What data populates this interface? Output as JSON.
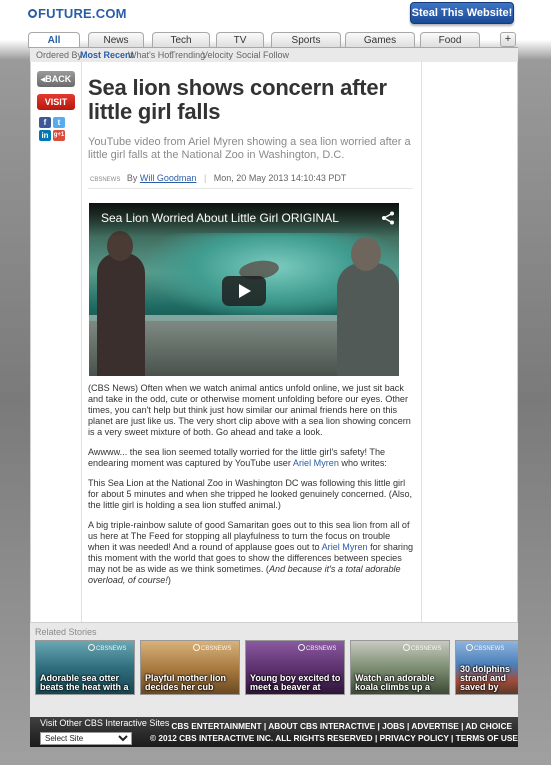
{
  "header": {
    "logo": "FUTURE.COM",
    "steal_button": "Steal This Website!"
  },
  "tabs": [
    {
      "label": "All",
      "active": true
    },
    {
      "label": "News"
    },
    {
      "label": "Tech"
    },
    {
      "label": "TV"
    },
    {
      "label": "Sports"
    },
    {
      "label": "Games"
    },
    {
      "label": "Food"
    }
  ],
  "tab_add_label": "+",
  "order_bar": {
    "label": "Ordered By",
    "options": [
      "Most Recent",
      "What's Hot",
      "Trending",
      "Velocity",
      "Social Follow"
    ]
  },
  "left_rail": {
    "back_label": "BACK",
    "visit_label": "VISIT",
    "share": {
      "facebook": "f",
      "twitter": "t",
      "linkedin": "in",
      "google": "g+1"
    }
  },
  "article": {
    "headline": "Sea lion shows concern after little girl falls",
    "subhead": "YouTube video from Ariel Myren showing a sea lion worried after a little girl falls at the National Zoo in Washington, D.C.",
    "source_logo": "CBSNEWS",
    "by_label": "By",
    "author": "Will Goodman",
    "date": "Mon, 20 May 2013 14:10:43 PDT",
    "video_title": "Sea Lion Worried About Little Girl ORIGINAL",
    "para1": "(CBS News) Often when we watch animal antics unfold online, we just sit back and take in the odd, cute or otherwise moment unfolding before our eyes. Other times, you can't help but think just how similar our animal friends here on this planet are just like us. The very short clip above with a sea lion showing concern is a very sweet mixture of both. Go ahead and take a look.",
    "para2_pre": "Awwww... the sea lion seemed totally worried for the little girl's safety! The endearing moment was captured by YouTube user ",
    "para2_link": "Ariel Myren",
    "para2_post": " who writes:",
    "para3": "This Sea Lion at the National Zoo in Washington DC was following this little girl for about 5 minutes and when she tripped he looked genuinely concerned. (Also, the little girl is holding a sea lion stuffed animal.)",
    "para4_pre": "A big triple-rainbow salute of good Samaritan goes out to this sea lion from all of us here at The Feed for stopping all playfulness to turn the focus on trouble when it was needed! And a round of applause goes out to ",
    "para4_link": "Ariel Myren",
    "para4_mid": " for sharing this moment with the world that goes to show the differences between species may not be as wide as we think sometimes. (",
    "para4_em": "And because it's a total adorable overload, of course!",
    "para4_post": ")"
  },
  "related": {
    "title": "Related Stories",
    "source": "CBSNEWS",
    "items": [
      {
        "caption": "Adorable sea otter beats the heat with a",
        "bg": "#3b7f93"
      },
      {
        "caption": "Playful mother lion decides her cub",
        "bg": "#b58a4a"
      },
      {
        "caption": "Young boy excited to meet a beaver at",
        "bg": "#6a3f7a"
      },
      {
        "caption": "Watch an adorable koala climbs up a",
        "bg": "#6f8a6b"
      },
      {
        "caption": "30 dolphins strand and saved by",
        "bg": "#3d6fa8"
      }
    ]
  },
  "footer": {
    "visit_other": "Visit Other CBS Interactive Sites",
    "select_value": "Select Site",
    "links": "CBS ENTERTAINMENT | ABOUT CBS INTERACTIVE | JOBS | ADVERTISE | AD CHOICE",
    "copyright": "© 2012 CBS INTERACTIVE INC. ALL RIGHTS RESERVED | PRIVACY POLICY | TERMS OF USE"
  }
}
